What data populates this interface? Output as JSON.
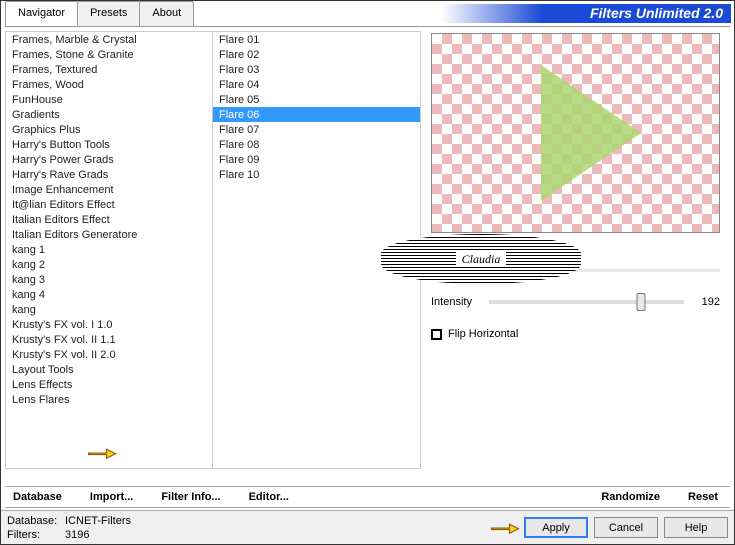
{
  "app_title": "Filters Unlimited 2.0",
  "tabs": {
    "navigator": "Navigator",
    "presets": "Presets",
    "about": "About"
  },
  "categories": [
    "Frames, Marble & Crystal",
    "Frames, Stone & Granite",
    "Frames, Textured",
    "Frames, Wood",
    "FunHouse",
    "Gradients",
    "Graphics Plus",
    "Harry's Button Tools",
    "Harry's Power Grads",
    "Harry's Rave Grads",
    "Image Enhancement",
    "It@lian Editors Effect",
    "Italian Editors Effect",
    "Italian Editors Generatore",
    "kang 1",
    "kang 2",
    "kang 3",
    "kang 4",
    "kang",
    "Krusty's FX vol. I 1.0",
    "Krusty's FX vol. II 1.1",
    "Krusty's FX vol. II 2.0",
    "Layout Tools",
    "Lens Effects",
    "Lens Flares"
  ],
  "flares": [
    "Flare 01",
    "Flare 02",
    "Flare 03",
    "Flare 04",
    "Flare 05",
    "Flare 06",
    "Flare 07",
    "Flare 08",
    "Flare 09",
    "Flare 10"
  ],
  "selected_flare_index": 5,
  "preview_label": "Flare 06",
  "intensity": {
    "label": "Intensity",
    "value": "192"
  },
  "flip_horizontal_label": "Flip Horizontal",
  "actions": {
    "database": "Database",
    "import": "Import...",
    "filter_info": "Filter Info...",
    "editor": "Editor...",
    "randomize": "Randomize",
    "reset": "Reset"
  },
  "footer": {
    "db_label": "Database:",
    "db_value": "ICNET-Filters",
    "filters_label": "Filters:",
    "filters_value": "3196"
  },
  "buttons": {
    "apply": "Apply",
    "cancel": "Cancel",
    "help": "Help"
  },
  "watermark": "Claudia"
}
